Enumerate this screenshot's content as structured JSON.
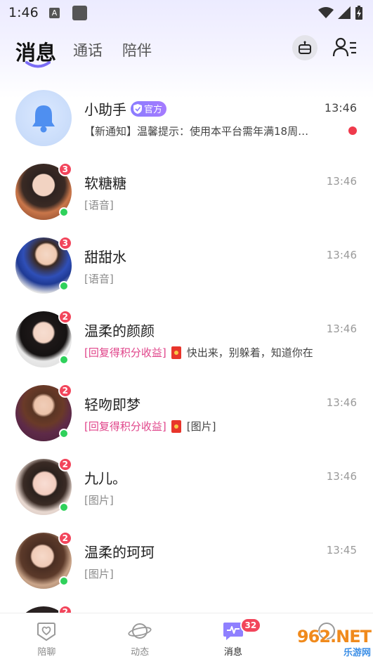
{
  "status_bar": {
    "time": "1:46",
    "notif_letter": "A"
  },
  "header": {
    "tabs": [
      {
        "label": "消息",
        "active": true
      },
      {
        "label": "通话",
        "active": false
      },
      {
        "label": "陪伴",
        "active": false
      }
    ]
  },
  "conversations": [
    {
      "name": "小助手",
      "official_tag": "官方",
      "time": "13:46",
      "preview": "【新通知】温馨提示：使用本平台需年满18周…",
      "unread_dot": true
    },
    {
      "name": "软糖糖",
      "time": "13:46",
      "preview": "[语音]",
      "badge": "3",
      "online": true
    },
    {
      "name": "甜甜水",
      "time": "13:46",
      "preview": "[语音]",
      "badge": "3",
      "online": true
    },
    {
      "name": "温柔的颜颜",
      "time": "13:46",
      "preview_tag": "[回复得积分收益]",
      "preview": "快出来，别躲着，知道你在",
      "badge": "2",
      "online": true
    },
    {
      "name": "轻吻即梦",
      "time": "13:46",
      "preview_tag": "[回复得积分收益]",
      "preview": "[图片]",
      "badge": "2",
      "online": true
    },
    {
      "name": "九儿。",
      "time": "13:46",
      "preview": "[图片]",
      "badge": "2",
      "online": true
    },
    {
      "name": "温柔的珂珂",
      "time": "13:45",
      "preview": "[图片]",
      "badge": "2",
      "online": true
    },
    {
      "badge": "2"
    }
  ],
  "bottom_nav": {
    "items": [
      {
        "label": "陪聊",
        "icon": "heart-shield-icon"
      },
      {
        "label": "动态",
        "icon": "planet-icon"
      },
      {
        "label": "消息",
        "icon": "message-pulse-icon",
        "badge": "32",
        "active": true
      },
      {
        "label": "",
        "icon": "profile-icon"
      }
    ]
  },
  "watermark": {
    "main": "962.NET",
    "sub": "乐游网"
  },
  "colors": {
    "accent": "#8a7cff",
    "badge": "#f2455b",
    "online": "#2fd15b",
    "pink_text": "#e0448a"
  }
}
